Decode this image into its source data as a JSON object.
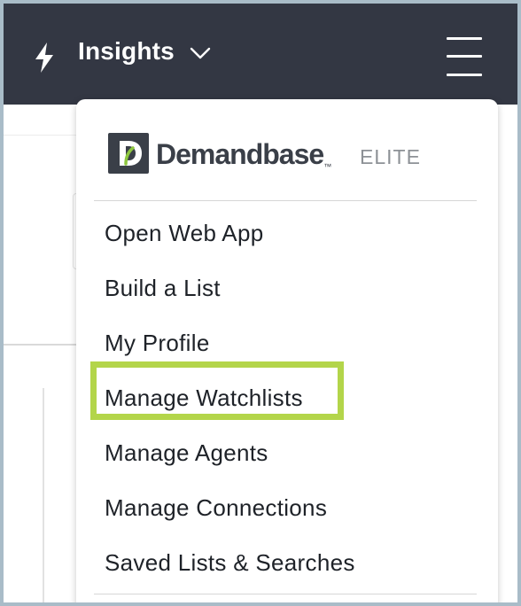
{
  "header": {
    "app_title": "Insights",
    "icons": {
      "app_icon": "lightning-bolt-icon",
      "dropdown": "chevron-down-icon",
      "menu": "hamburger-menu-icon"
    }
  },
  "menu": {
    "brand": {
      "name": "Demandbase",
      "trademark": "™",
      "tier": "ELITE",
      "logo_icon": "demandbase-logo-icon"
    },
    "items": [
      {
        "label": "Open Web App"
      },
      {
        "label": "Build a List"
      },
      {
        "label": "My Profile"
      },
      {
        "label": "Manage Watchlists",
        "highlighted": true
      },
      {
        "label": "Manage Agents"
      },
      {
        "label": "Manage Connections"
      },
      {
        "label": "Saved Lists & Searches"
      }
    ]
  },
  "colors": {
    "header_bg": "#333743",
    "highlight": "#b3d54a",
    "frame_border": "#a9bcc8",
    "brand_green": "#8dc63f"
  }
}
